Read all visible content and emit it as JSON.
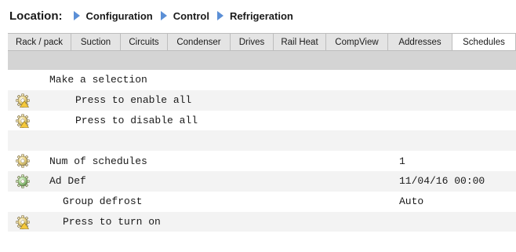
{
  "breadcrumb": {
    "prefix": "Location:",
    "items": [
      {
        "label": "Configuration"
      },
      {
        "label": "Control"
      },
      {
        "label": "Refrigeration"
      }
    ]
  },
  "tabs": [
    {
      "label": "Rack / pack",
      "width": 81
    },
    {
      "label": "Suction",
      "width": 63
    },
    {
      "label": "Circuits",
      "width": 60
    },
    {
      "label": "Condenser",
      "width": 80
    },
    {
      "label": "Drives",
      "width": 55
    },
    {
      "label": "Rail Heat",
      "width": 67
    },
    {
      "label": "CompView",
      "width": 79
    },
    {
      "label": "Addresses",
      "width": 82
    },
    {
      "label": "Schedules",
      "width": 81,
      "active": true
    }
  ],
  "rows": [
    {
      "label": "Make a selection",
      "value": "",
      "icon": null,
      "indent": 53,
      "shade": false
    },
    {
      "label": "Press to enable all",
      "value": "",
      "icon": "gear-warning-icon",
      "indent": 86,
      "shade": true
    },
    {
      "label": "Press to disable all",
      "value": "",
      "icon": "gear-warning-icon",
      "indent": 86,
      "shade": false
    },
    {
      "label": "",
      "value": "",
      "icon": null,
      "indent": 53,
      "shade": true
    },
    {
      "label": "Num of schedules",
      "value": "1",
      "icon": "gear-icon",
      "indent": 53,
      "shade": false
    },
    {
      "label": "Ad Def",
      "value": "11/04/16 00:00",
      "icon": "gear-green-icon",
      "indent": 53,
      "shade": true
    },
    {
      "label": "Group defrost",
      "value": "Auto",
      "icon": null,
      "indent": 70,
      "shade": false
    },
    {
      "label": "Press to turn on",
      "value": "",
      "icon": "gear-warning-icon",
      "indent": 70,
      "shade": true
    },
    {
      "label": "",
      "value": "",
      "icon": null,
      "indent": 53,
      "shade": false
    }
  ],
  "colors": {
    "breadcrumb_arrow": "#5b8fd6",
    "tab_bar": "#e4e4e4",
    "gray_bar": "#d4d4d4",
    "row_shade": "#f3f3f3"
  }
}
